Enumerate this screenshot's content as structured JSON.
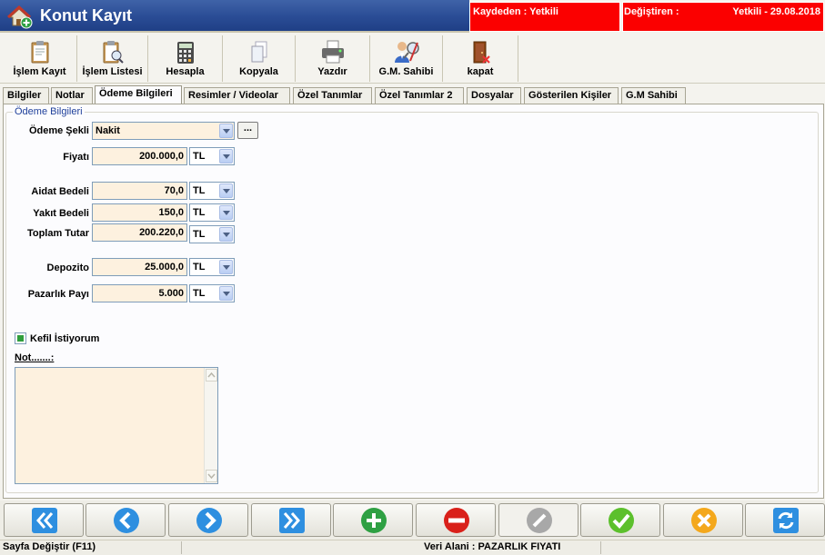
{
  "window": {
    "title": "Konut Kayıt",
    "icon": "house-plus-icon"
  },
  "audit": {
    "created_by_label": "Kaydeden : Yetkili",
    "modified_label": "Değiştiren :",
    "modified_value": "Yetkili - 29.08.2018",
    "bg_color": "#fb0000"
  },
  "toolbar": [
    {
      "label": "İşlem Kayıt",
      "icon": "clipboard-icon"
    },
    {
      "label": "İşlem Listesi",
      "icon": "clipboard-search-icon"
    },
    {
      "label": "Hesapla",
      "icon": "calculator-icon"
    },
    {
      "label": "Kopyala",
      "icon": "copy-icon"
    },
    {
      "label": "Yazdır",
      "icon": "printer-icon"
    },
    {
      "label": "G.M. Sahibi",
      "icon": "owner-search-icon"
    },
    {
      "label": "kapat",
      "icon": "exit-door-icon"
    }
  ],
  "tabs": [
    "Bilgiler",
    "Notlar",
    "Ödeme Bilgileri",
    "Resimler / Videolar",
    "Özel Tanımlar",
    "Özel Tanımlar 2",
    "Dosyalar",
    "Gösterilen Kişiler",
    "G.M Sahibi"
  ],
  "active_tab": "Ödeme Bilgileri",
  "form": {
    "group_title": "Ödeme Bilgileri",
    "odeme_sekli_label": "Ödeme Şekli",
    "odeme_sekli_value": "Nakit",
    "dots_button": "...",
    "fiyati_label": "Fiyatı",
    "fiyati_value": "200.000,0",
    "fiyati_currency": "TL",
    "aidat_label": "Aidat  Bedeli",
    "aidat_value": "70,0",
    "aidat_currency": "TL",
    "yakit_label": "Yakıt Bedeli",
    "yakit_value": "150,0",
    "yakit_currency": "TL",
    "toplam_label": "Toplam Tutar",
    "toplam_value": "200.220,0",
    "toplam_currency": "TL",
    "depozito_label": "Depozito",
    "depozito_value": "25.000,0",
    "depozito_currency": "TL",
    "pazarlik_label": "Pazarlık Payı",
    "pazarlik_value": "5.000",
    "pazarlik_currency": "TL",
    "kefil_label": "Kefil İstiyorum",
    "kefil_checked": true,
    "not_label": "Not.......:",
    "not_value": ""
  },
  "nav_buttons": [
    {
      "name": "first-record-button",
      "icon": "double-left-arrow-icon"
    },
    {
      "name": "previous-record-button",
      "icon": "left-arrow-icon"
    },
    {
      "name": "next-record-button",
      "icon": "right-arrow-icon"
    },
    {
      "name": "last-record-button",
      "icon": "double-right-arrow-icon"
    },
    {
      "name": "add-record-button",
      "icon": "plus-icon"
    },
    {
      "name": "delete-record-button",
      "icon": "minus-icon"
    },
    {
      "name": "edit-record-button",
      "icon": "pencil-icon",
      "disabled": true
    },
    {
      "name": "save-record-button",
      "icon": "checkmark-icon"
    },
    {
      "name": "cancel-record-button",
      "icon": "x-icon"
    },
    {
      "name": "refresh-button",
      "icon": "refresh-icon"
    }
  ],
  "status": {
    "left": "Sayfa Değiştir (F11)",
    "center": "Veri Alani : PAZARLIK  FIYATI"
  }
}
